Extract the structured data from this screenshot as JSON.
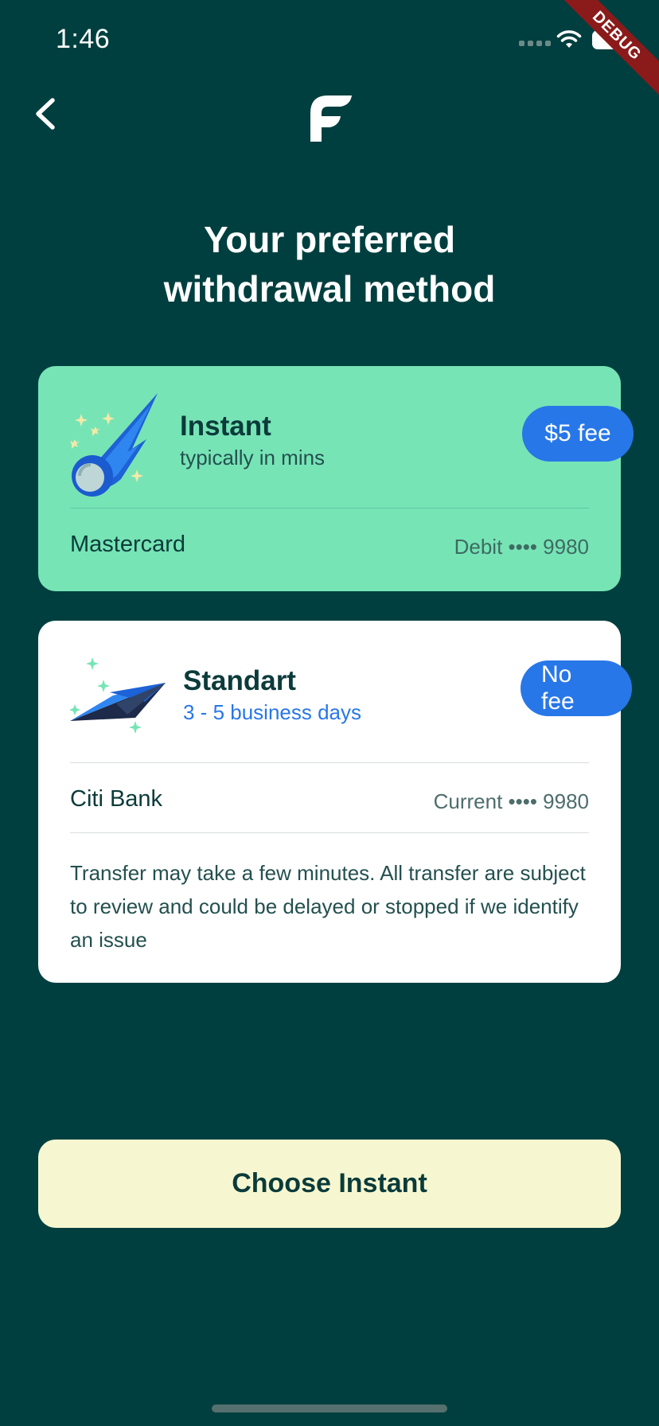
{
  "status_bar": {
    "time": "1:46",
    "debug_label": "DEBUG"
  },
  "header": {
    "back_icon": "chevron-left-icon",
    "logo_icon": "brand-f-logo"
  },
  "page": {
    "title_line1": "Your preferred",
    "title_line2": "withdrawal method"
  },
  "options": [
    {
      "name": "Instant",
      "subtitle": "typically in mins",
      "subtitle_color": "#24504f",
      "fee": "$5 fee",
      "icon": "comet-icon",
      "account_name": "Mastercard",
      "account_detail": "Debit •••• 9980",
      "background": "#77e4b6",
      "selected": true
    },
    {
      "name": "Standart",
      "subtitle": "3 - 5 business days",
      "subtitle_color": "#2877e8",
      "fee": "No fee",
      "icon": "paper-plane-icon",
      "account_name": "Citi Bank",
      "account_detail": "Current •••• 9980",
      "background": "#ffffff",
      "disclaimer": "Transfer may take a few minutes. All transfer are subject to review and could be delayed or stopped if we identify an issue",
      "selected": false
    }
  ],
  "cta": {
    "label": "Choose Instant"
  },
  "colors": {
    "background": "#003f3f",
    "accent_blue": "#2877e8",
    "mint": "#77e4b6",
    "cta_bg": "#f6f7d1"
  }
}
